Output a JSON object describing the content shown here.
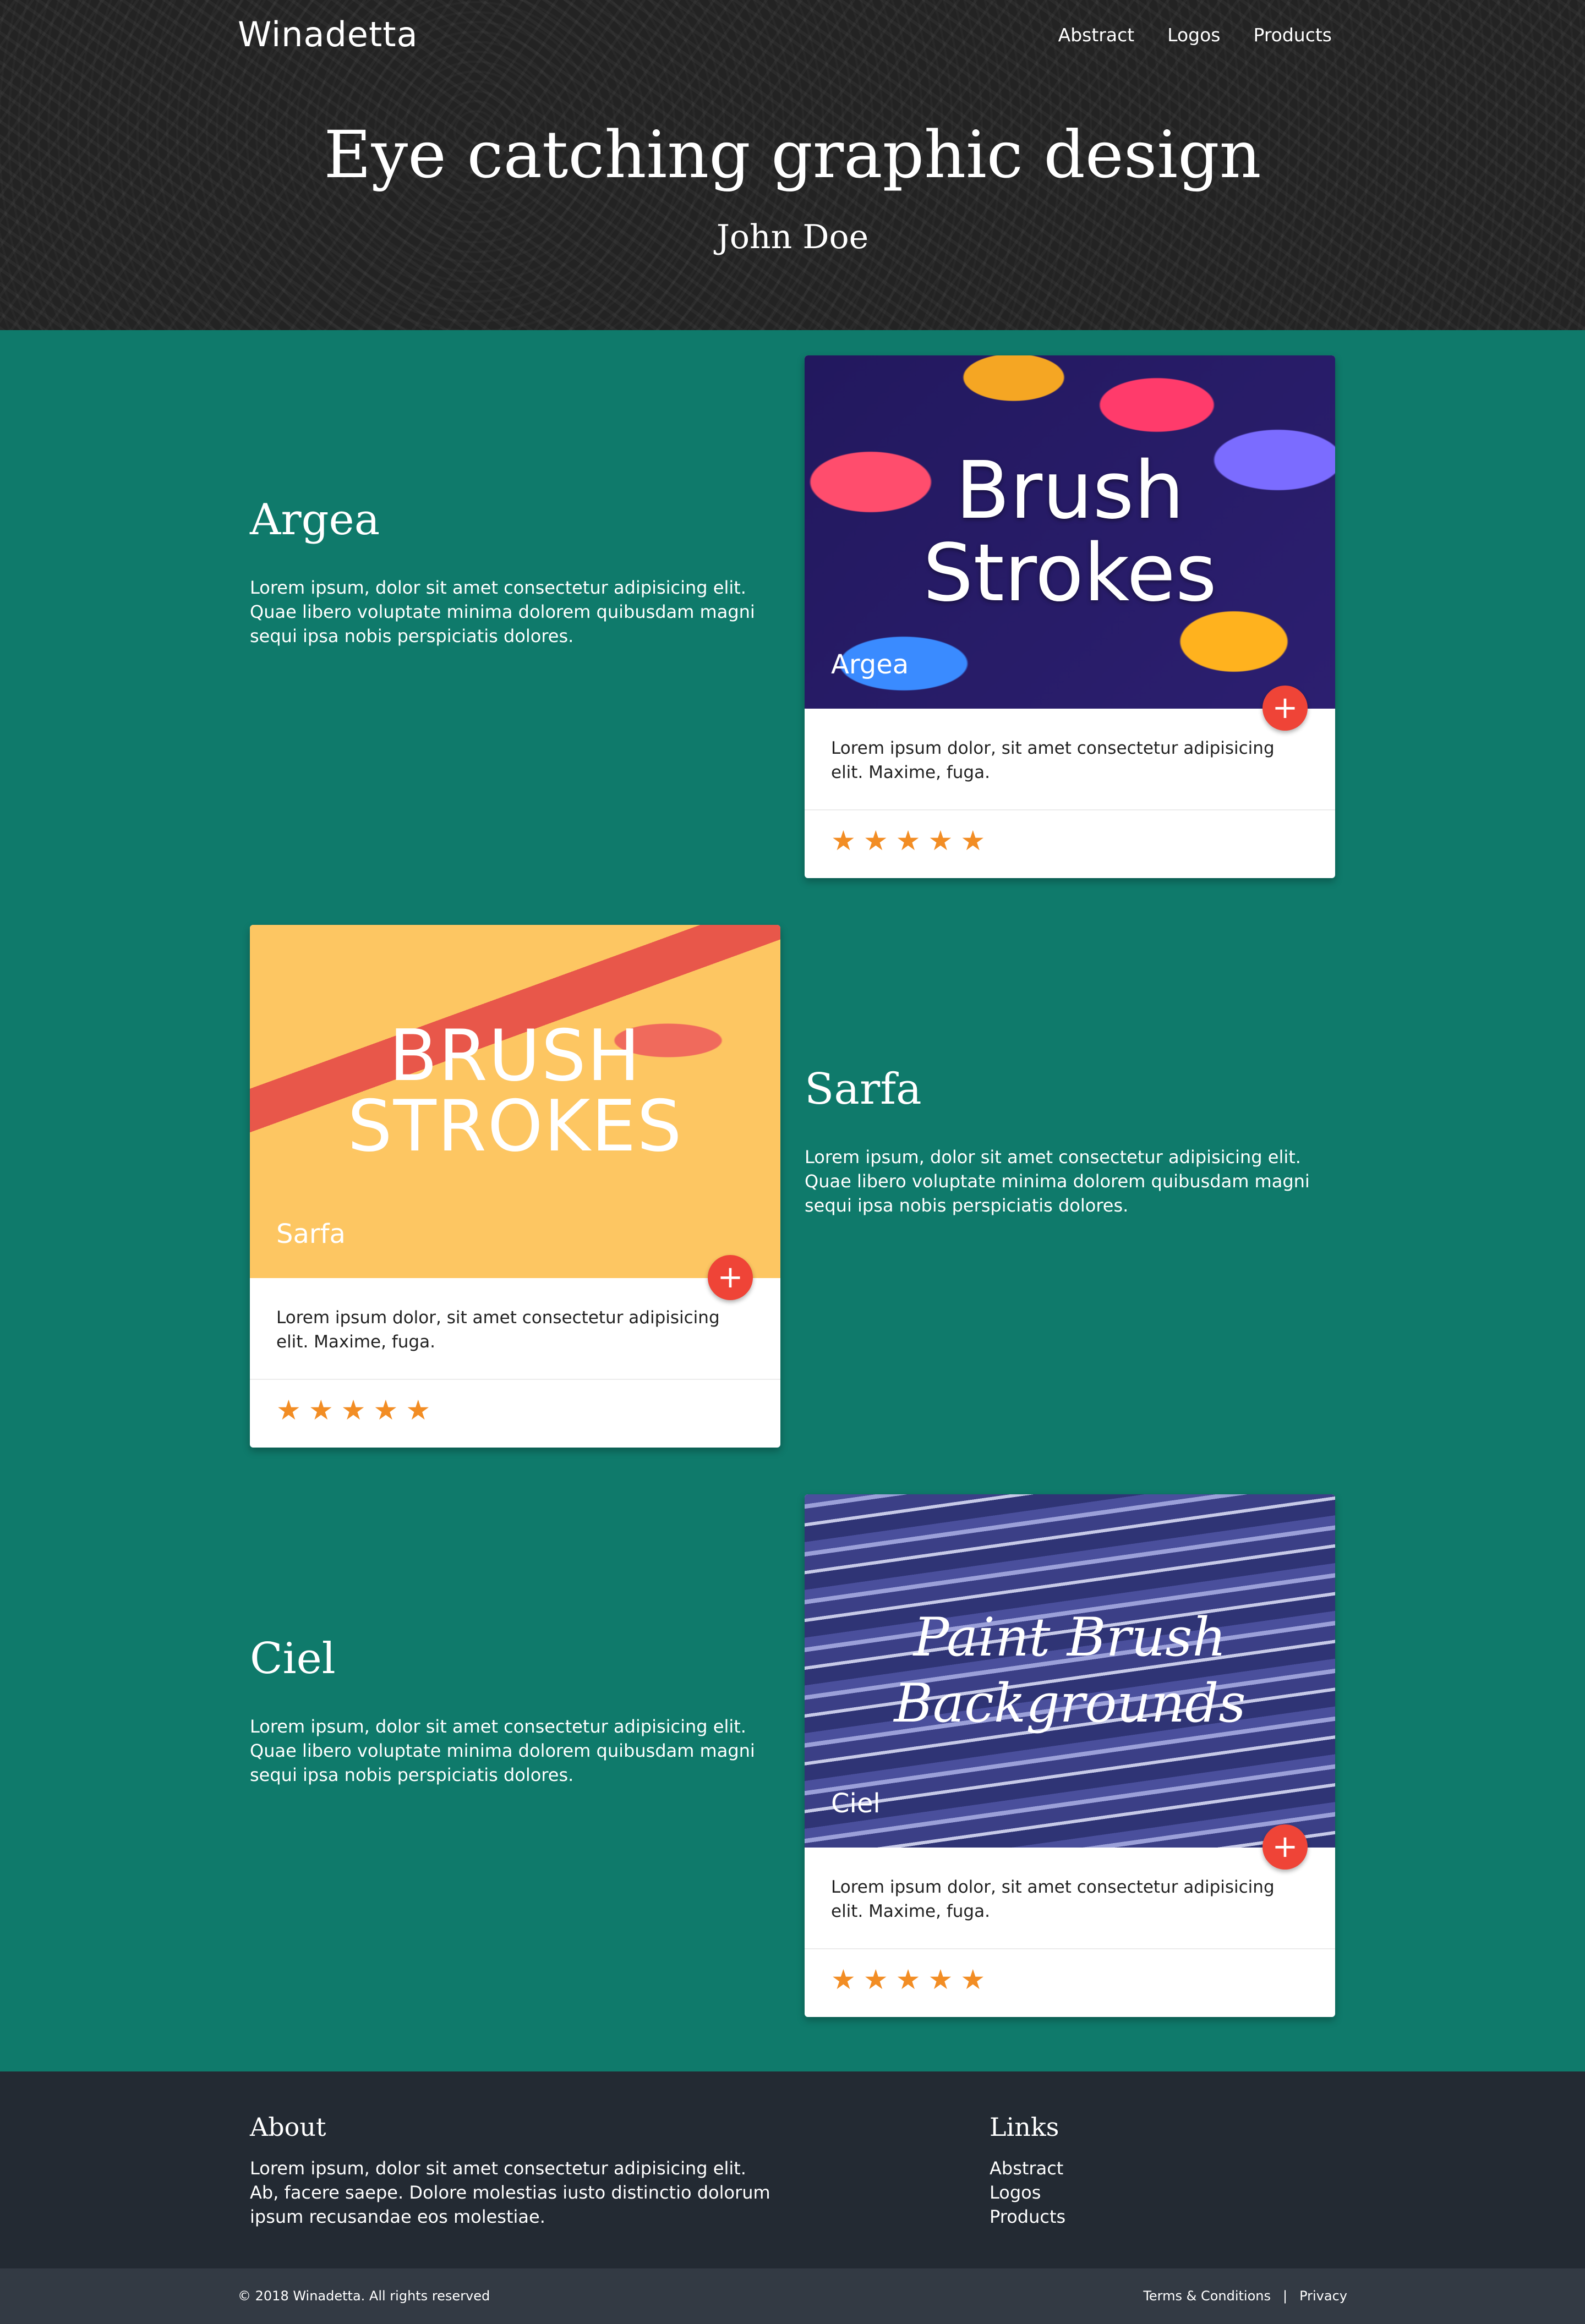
{
  "header": {
    "brand": "Winadetta",
    "nav": [
      "Abstract",
      "Logos",
      "Products"
    ],
    "title": "Eye catching graphic design",
    "subtitle": "John Doe"
  },
  "sections": [
    {
      "title": "Argea",
      "text": "Lorem ipsum, dolor sit amet consectetur adipisicing elit. Quae libero voluptate minima dolorem quibusdam magni sequi ipsa nobis perspiciatis dolores.",
      "card": {
        "image_text": "Brush Strokes",
        "caption": "Argea",
        "body": "Lorem ipsum dolor, sit amet consectetur adipisicing elit. Maxime, fuga.",
        "rating": 5,
        "fab_icon": "plus-icon"
      }
    },
    {
      "title": "Sarfa",
      "text": "Lorem ipsum, dolor sit amet consectetur adipisicing elit. Quae libero voluptate minima dolorem quibusdam magni sequi ipsa nobis perspiciatis dolores.",
      "card": {
        "image_text": "BRUSH STROKES",
        "caption": "Sarfa",
        "body": "Lorem ipsum dolor, sit amet consectetur adipisicing elit. Maxime, fuga.",
        "rating": 5,
        "fab_icon": "plus-icon"
      }
    },
    {
      "title": "Ciel",
      "text": "Lorem ipsum, dolor sit amet consectetur adipisicing elit. Quae libero voluptate minima dolorem quibusdam magni sequi ipsa nobis perspiciatis dolores.",
      "card": {
        "image_text": "Paint Brush Backgrounds",
        "caption": "Ciel",
        "body": "Lorem ipsum dolor, sit amet consectetur adipisicing elit. Maxime, fuga.",
        "rating": 5,
        "fab_icon": "plus-icon"
      }
    }
  ],
  "footer": {
    "about_title": "About",
    "about_text": "Lorem ipsum, dolor sit amet consectetur adipisicing elit. Ab, facere saepe. Dolore molestias iusto distinctio dolorum ipsum recusandae eos molestiae.",
    "links_title": "Links",
    "links": [
      "Abstract",
      "Logos",
      "Products"
    ],
    "copyright": "© 2018 Winadetta. All rights reserved",
    "legal": [
      "Terms & Conditions",
      "Privacy"
    ],
    "legal_separator": "|"
  },
  "colors": {
    "main_bg": "#0f7a6b",
    "header_bg": "#232323",
    "footer_bg": "#232a33",
    "bottom_bar_bg": "#333a44",
    "fab": "#ef4437",
    "star": "#f28d24"
  }
}
